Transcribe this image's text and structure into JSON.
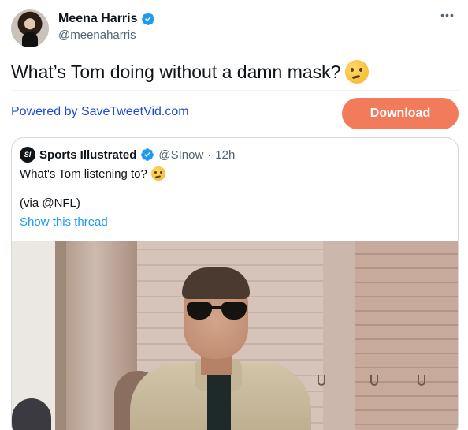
{
  "tweet": {
    "author_name": "Meena Harris",
    "author_handle": "@meenaharris",
    "text": "What’s Tom doing without a damn mask?",
    "emoji_icon": "thinking-face-emoji"
  },
  "embed_bar": {
    "powered_by": "Powered by SaveTweetVid.com",
    "download_label": "Download",
    "download_color": "#f27b5c",
    "link_color": "#1d4bd6"
  },
  "quoted_tweet": {
    "logo_text": "SI",
    "author_name": "Sports Illustrated",
    "author_handle": "@SInow",
    "separator": "·",
    "time": "12h",
    "text": "What's Tom listening to?",
    "via": "(via @NFL)",
    "show_thread": "Show this thread",
    "media_description_icon": "video-thumbnail"
  },
  "colors": {
    "verified": "#1d9bf0",
    "secondary_text": "#536471",
    "thread_link": "#1d9bf0"
  }
}
